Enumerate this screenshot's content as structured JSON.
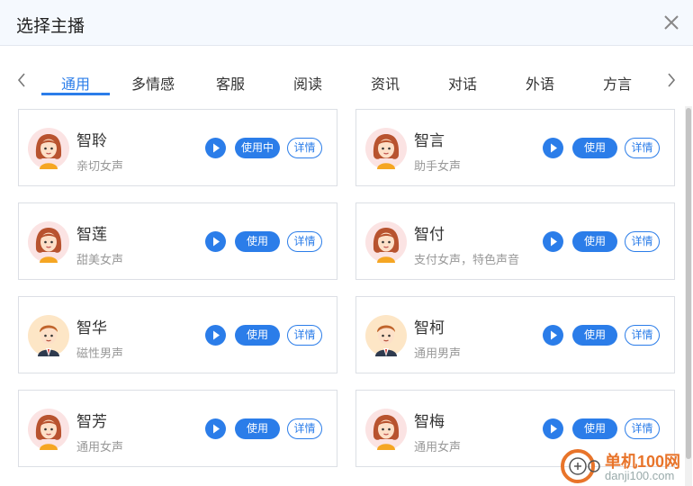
{
  "dialog": {
    "title": "选择主播",
    "close_icon": "close-icon"
  },
  "tabs": {
    "items": [
      "通用",
      "多情感",
      "客服",
      "阅读",
      "资讯",
      "对话",
      "外语",
      "方言"
    ],
    "active_index": 0
  },
  "voices": [
    {
      "name": "智聆",
      "desc": "亲切女声",
      "gender": "female",
      "use_label": "使用中",
      "detail_label": "详情"
    },
    {
      "name": "智言",
      "desc": "助手女声",
      "gender": "female",
      "use_label": "使用",
      "detail_label": "详情"
    },
    {
      "name": "智莲",
      "desc": "甜美女声",
      "gender": "female",
      "use_label": "使用",
      "detail_label": "详情"
    },
    {
      "name": "智付",
      "desc": "支付女声，特色声音",
      "gender": "female",
      "use_label": "使用",
      "detail_label": "详情"
    },
    {
      "name": "智华",
      "desc": "磁性男声",
      "gender": "male",
      "use_label": "使用",
      "detail_label": "详情"
    },
    {
      "name": "智柯",
      "desc": "通用男声",
      "gender": "male",
      "use_label": "使用",
      "detail_label": "详情"
    },
    {
      "name": "智芳",
      "desc": "通用女声",
      "gender": "female",
      "use_label": "使用",
      "detail_label": "详情"
    },
    {
      "name": "智梅",
      "desc": "通用女声",
      "gender": "female",
      "use_label": "使用",
      "detail_label": "详情"
    }
  ],
  "watermark": {
    "line1": "单机100网",
    "line2": "danji100.com"
  },
  "colors": {
    "accent": "#2b7de9",
    "header_bg": "#f5f9fe"
  }
}
